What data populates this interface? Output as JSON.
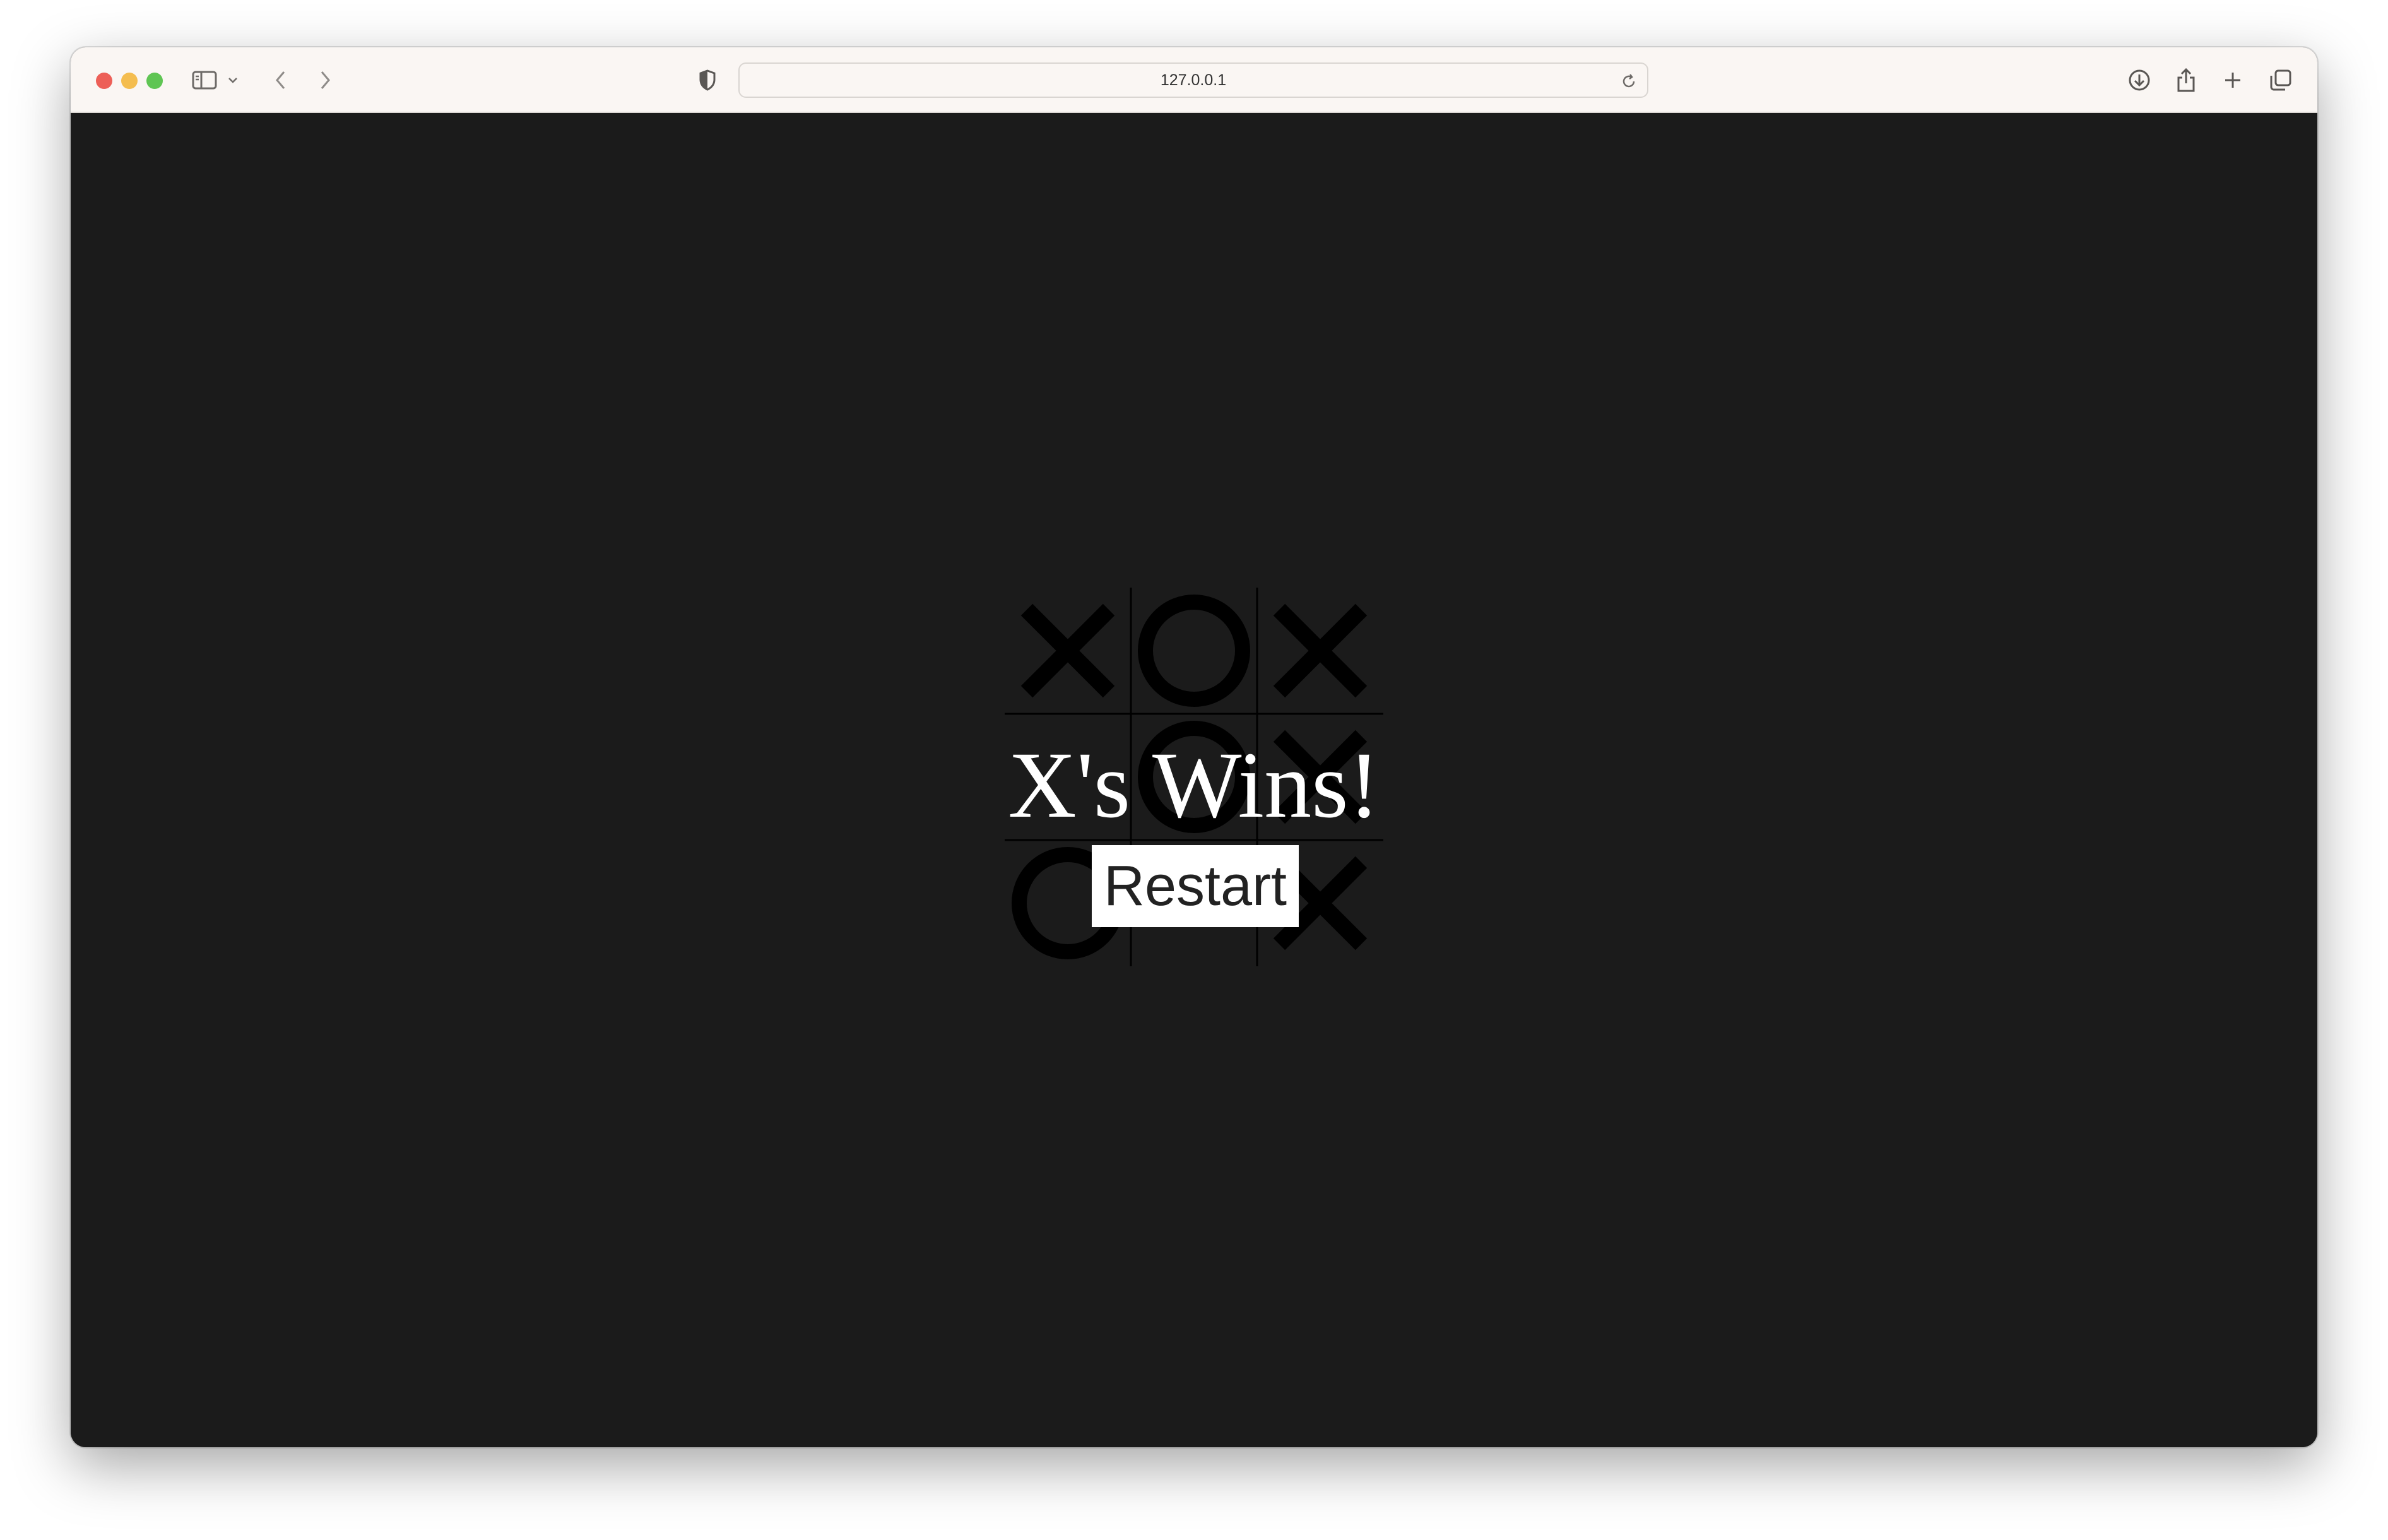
{
  "browser": {
    "url": "127.0.0.1",
    "icons": [
      "sidebar-icon",
      "chevron-down-icon",
      "back-icon",
      "forward-icon",
      "privacy-shield-icon",
      "reload-icon",
      "download-icon",
      "share-icon",
      "new-tab-icon",
      "tab-overview-icon"
    ]
  },
  "game": {
    "board": [
      "X",
      "O",
      "X",
      "",
      "O",
      "X",
      "O",
      "",
      "X"
    ],
    "winner_message": "X's Wins!",
    "restart_label": "Restart"
  },
  "colors": {
    "page_background": "#1b1b1b",
    "marks": "#000000",
    "overlay_text": "#ffffff",
    "toolbar": "#faf6f3"
  }
}
